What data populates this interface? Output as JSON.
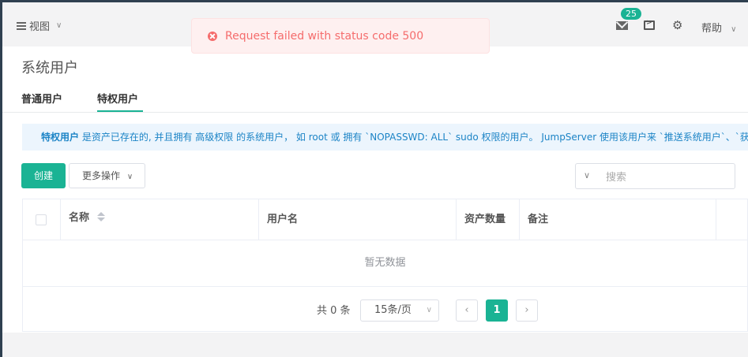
{
  "header": {
    "view_label": "视图",
    "notification_count": "25",
    "help_label": "帮助"
  },
  "toast": {
    "message": "Request failed with status code 500"
  },
  "page": {
    "title": "系统用户",
    "tabs": [
      {
        "label": "普通用户",
        "active": false
      },
      {
        "label": "特权用户",
        "active": true
      }
    ]
  },
  "info": {
    "strong": "特权用户",
    "text": " 是资产已存在的, 并且拥有 高级权限 的系统用户， 如 root 或 拥有 `NOPASSWD: ALL` sudo 权限的用户。 JumpServer 使用该用户来 `推送系统用户`、`获取资产"
  },
  "toolbar": {
    "create_label": "创建",
    "more_label": "更多操作",
    "search_placeholder": "搜索"
  },
  "table": {
    "columns": [
      "名称",
      "用户名",
      "资产数量",
      "备注"
    ],
    "empty_text": "暂无数据"
  },
  "pagination": {
    "total_text": "共 0 条",
    "page_size": "15条/页",
    "current_page": "1"
  },
  "colors": {
    "accent": "#1ab394",
    "error": "#f56c6c",
    "info_text": "#1c84c6"
  }
}
